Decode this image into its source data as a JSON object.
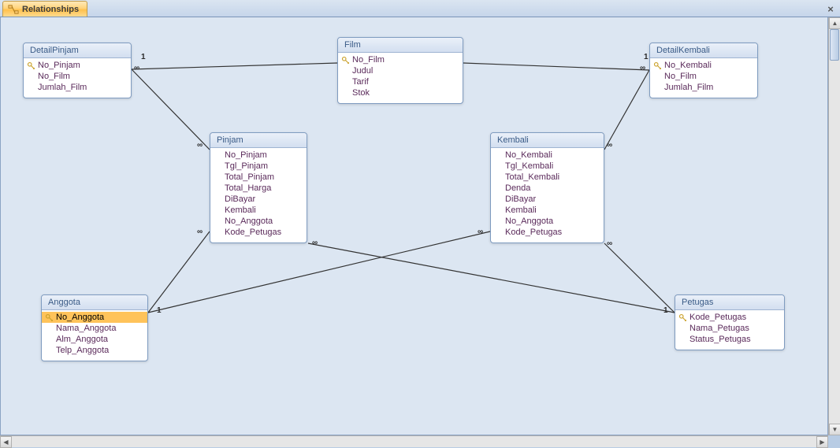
{
  "tab": {
    "title": "Relationships"
  },
  "tables": {
    "detailpinjam": {
      "name": "DetailPinjam",
      "fields": [
        {
          "name": "No_Pinjam",
          "pk": true
        },
        {
          "name": "No_Film"
        },
        {
          "name": "Jumlah_Film"
        }
      ]
    },
    "film": {
      "name": "Film",
      "fields": [
        {
          "name": "No_Film",
          "pk": true
        },
        {
          "name": "Judul"
        },
        {
          "name": "Tarif"
        },
        {
          "name": "Stok"
        }
      ]
    },
    "detailkembali": {
      "name": "DetailKembali",
      "fields": [
        {
          "name": "No_Kembali",
          "pk": true
        },
        {
          "name": "No_Film"
        },
        {
          "name": "Jumlah_Film"
        }
      ]
    },
    "pinjam": {
      "name": "Pinjam",
      "fields": [
        {
          "name": "No_Pinjam"
        },
        {
          "name": "Tgl_Pinjam"
        },
        {
          "name": "Total_Pinjam"
        },
        {
          "name": "Total_Harga"
        },
        {
          "name": "DiBayar"
        },
        {
          "name": "Kembali"
        },
        {
          "name": "No_Anggota"
        },
        {
          "name": "Kode_Petugas"
        }
      ]
    },
    "kembali": {
      "name": "Kembali",
      "fields": [
        {
          "name": "No_Kembali"
        },
        {
          "name": "Tgl_Kembali"
        },
        {
          "name": "Total_Kembali"
        },
        {
          "name": "Denda"
        },
        {
          "name": "DiBayar"
        },
        {
          "name": "Kembali"
        },
        {
          "name": "No_Anggota"
        },
        {
          "name": "Kode_Petugas"
        }
      ]
    },
    "anggota": {
      "name": "Anggota",
      "fields": [
        {
          "name": "No_Anggota",
          "pk": true,
          "selected": true
        },
        {
          "name": "Nama_Anggota"
        },
        {
          "name": "Alm_Anggota"
        },
        {
          "name": "Telp_Anggota"
        }
      ]
    },
    "petugas": {
      "name": "Petugas",
      "fields": [
        {
          "name": "Kode_Petugas",
          "pk": true
        },
        {
          "name": "Nama_Petugas"
        },
        {
          "name": "Status_Petugas"
        }
      ]
    }
  },
  "relationships": [
    {
      "from": "film.No_Film",
      "to": "detailpinjam.No_Film",
      "type": "1-to-many"
    },
    {
      "from": "film.No_Film",
      "to": "detailkembali.No_Film",
      "type": "1-to-many"
    },
    {
      "from": "pinjam.No_Pinjam",
      "to": "detailpinjam.No_Pinjam",
      "type": "1-to-many"
    },
    {
      "from": "kembali.No_Kembali",
      "to": "detailkembali.No_Kembali",
      "type": "1-to-many"
    },
    {
      "from": "anggota.No_Anggota",
      "to": "pinjam.No_Anggota",
      "type": "1-to-many"
    },
    {
      "from": "anggota.No_Anggota",
      "to": "kembali.No_Anggota",
      "type": "1-to-many"
    },
    {
      "from": "petugas.Kode_Petugas",
      "to": "pinjam.Kode_Petugas",
      "type": "1-to-many"
    },
    {
      "from": "petugas.Kode_Petugas",
      "to": "kembali.Kode_Petugas",
      "type": "1-to-many"
    }
  ],
  "labels": {
    "one": "1",
    "many": "∞"
  }
}
